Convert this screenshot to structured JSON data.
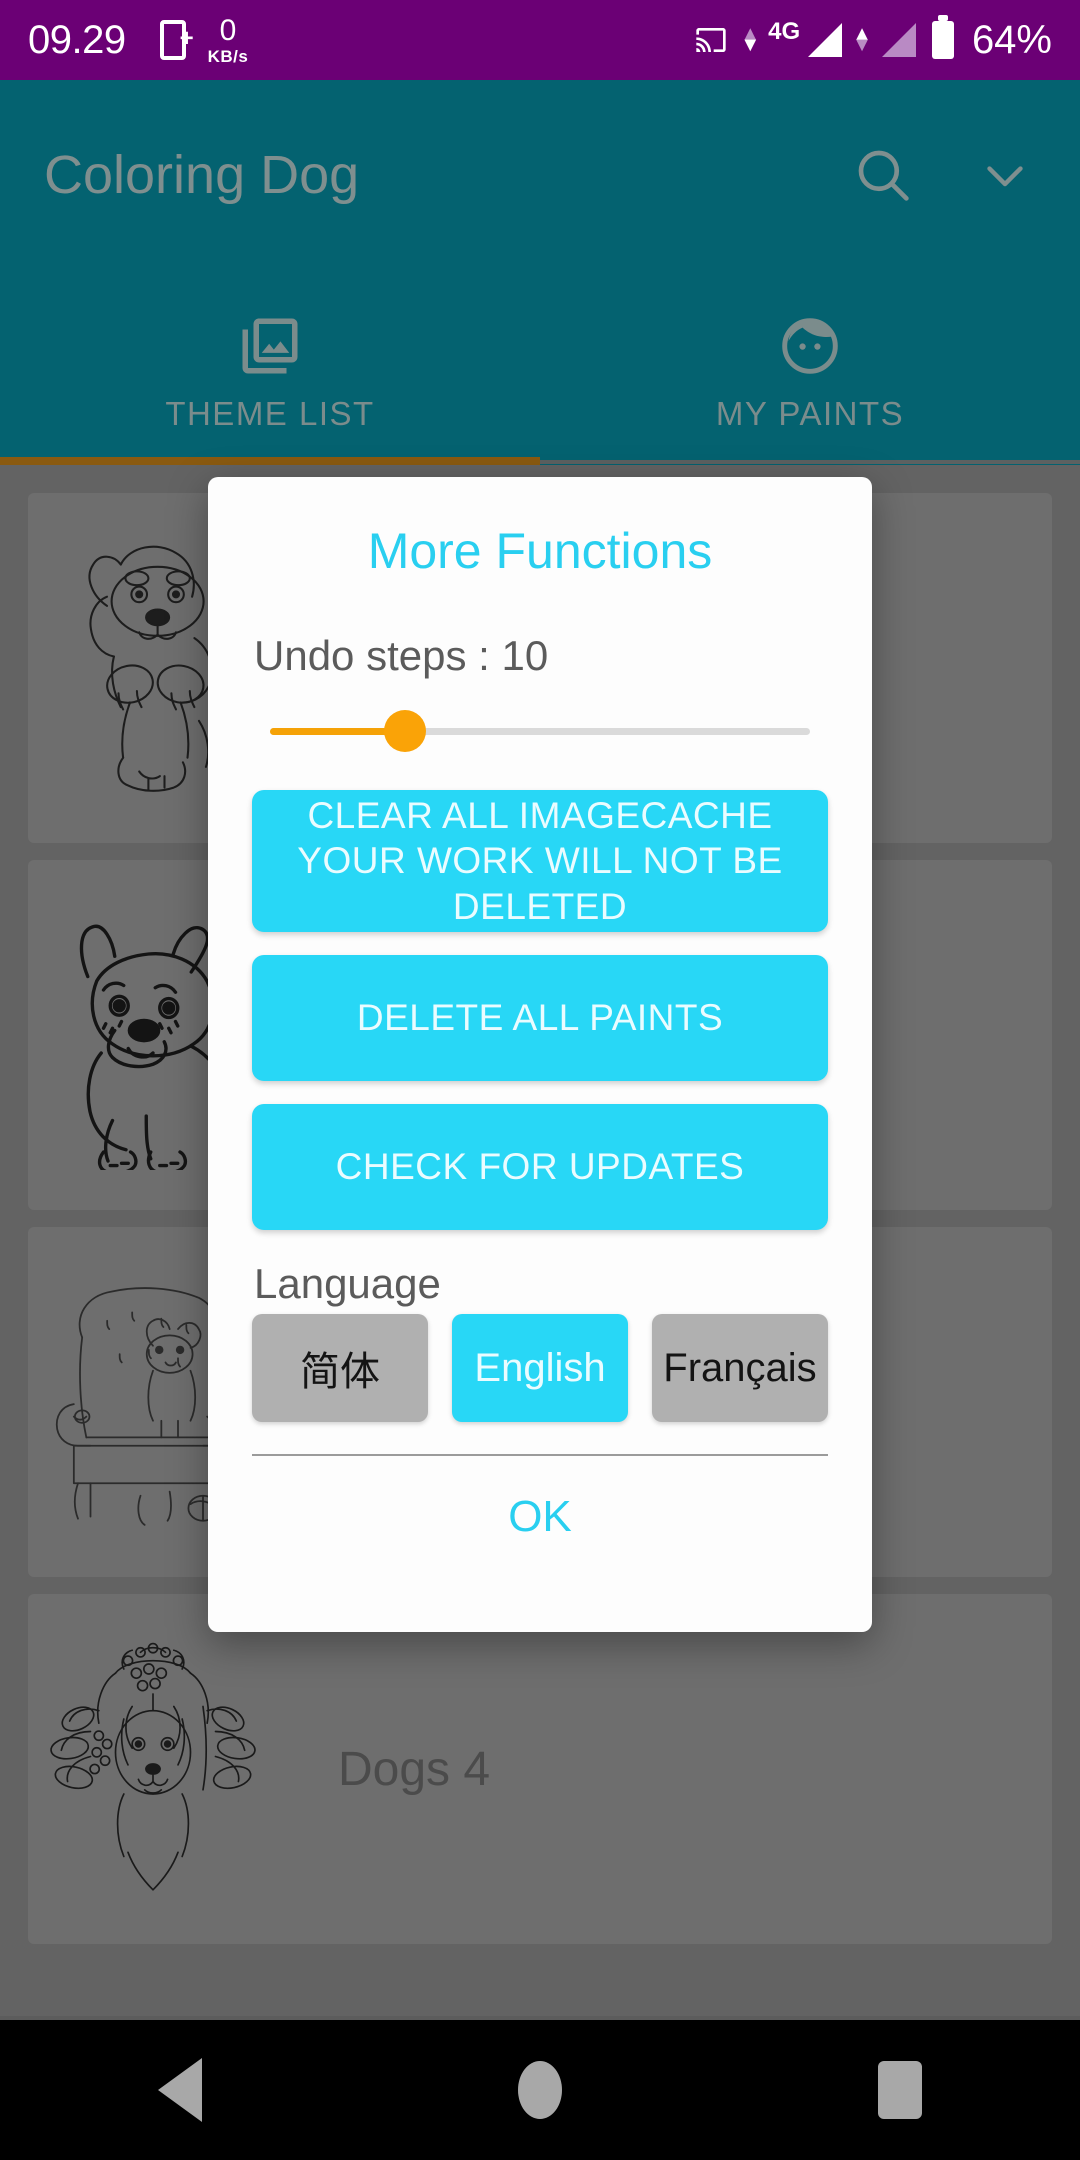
{
  "status_bar": {
    "clock": "09.29",
    "sim_icon": "sim-card-add-icon",
    "net_speed_value": "0",
    "net_speed_unit": "KB/s",
    "cast_icon": "cast-screen-icon",
    "network_type": "4G",
    "signal_icon": "signal-bars-icon",
    "battery_icon": "battery-icon",
    "battery_percent": "64%",
    "background_color": "#6B0075"
  },
  "app_bar": {
    "title": "Coloring Dog",
    "search_icon": "search-icon",
    "overflow_icon": "chevron-down-icon",
    "background_color": "#046270"
  },
  "tabs": {
    "active_index": 0,
    "indicator_color": "#8a5a10",
    "items": [
      {
        "label": "THEME LIST",
        "icon": "photo-library-icon"
      },
      {
        "label": "MY PAINTS",
        "icon": "face-icon"
      }
    ]
  },
  "content": {
    "cards": [
      {
        "title": "",
        "thumb": "dog-sitting-line-art"
      },
      {
        "title": "",
        "thumb": "bulldog-line-art"
      },
      {
        "title": "",
        "thumb": "dog-armchair-line-art"
      },
      {
        "title": "Dogs 4",
        "thumb": "dog-floral-line-art"
      }
    ]
  },
  "dialog": {
    "title": "More Functions",
    "undo": {
      "label": "Undo steps : 10",
      "value": 10,
      "min": 0,
      "max": 40,
      "percent": 25,
      "track_color": "#dadada",
      "fill_color": "#F5A207",
      "thumb_color": "#FAA307"
    },
    "buttons": {
      "clear_cache": "CLEAR ALL IMAGECACHE YOUR WORK WILL NOT BE DELETED",
      "delete_paints": "DELETE ALL PAINTS",
      "check_updates": "CHECK FOR UPDATES"
    },
    "language": {
      "label": "Language",
      "selected": "English",
      "options": [
        {
          "label": "简体",
          "selected": false
        },
        {
          "label": "English",
          "selected": true
        },
        {
          "label": "Français",
          "selected": false
        }
      ]
    },
    "ok_label": "OK",
    "accent_color": "#29CFF0",
    "button_color": "#28D7F6"
  },
  "nav_bar": {
    "back_icon": "back-triangle-icon",
    "home_icon": "home-circle-icon",
    "recents_icon": "recents-square-icon"
  }
}
